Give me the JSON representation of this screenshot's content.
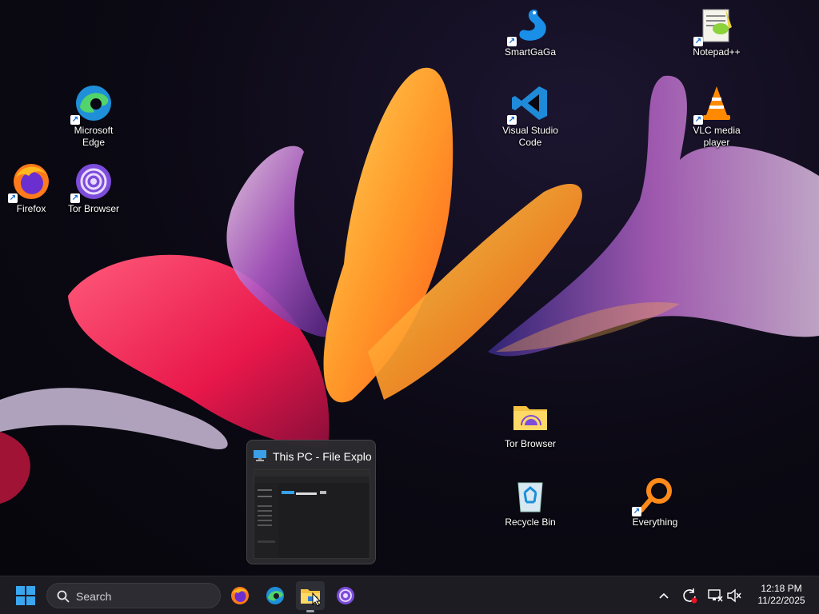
{
  "desktop": {
    "icons": {
      "edge": {
        "label": "Microsoft\nEdge"
      },
      "firefox": {
        "label": "Firefox"
      },
      "tor_browser": {
        "label": "Tor Browser"
      },
      "smartgaga": {
        "label": "SmartGaGa"
      },
      "vscode": {
        "label": "Visual Studio\nCode"
      },
      "notepadpp": {
        "label": "Notepad++"
      },
      "vlc": {
        "label": "VLC media\nplayer"
      },
      "tor_folder": {
        "label": "Tor Browser"
      },
      "recycle_bin": {
        "label": "Recycle Bin"
      },
      "everything": {
        "label": "Everything"
      }
    }
  },
  "preview": {
    "title": "This PC - File Explo..."
  },
  "taskbar": {
    "search_placeholder": "Search",
    "clock": {
      "time": "12:18 PM",
      "date": "11/22/2025"
    }
  },
  "colors": {
    "accent": "#0078d4",
    "taskbar_bg": "#1c1c22",
    "tor_purple": "#7d4cdb"
  }
}
